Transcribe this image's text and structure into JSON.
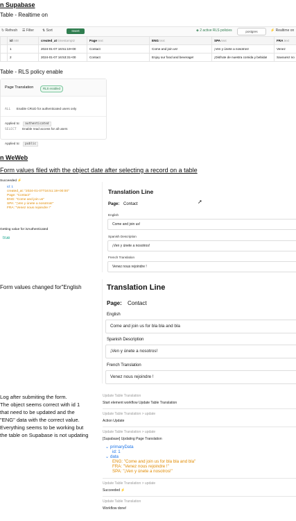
{
  "supabase": {
    "heading": "n Supabase",
    "subheading": "Table - Realtime on",
    "toolbar": {
      "refresh": "Refresh",
      "filter": "Filter",
      "sort": "Sort",
      "insert": "Insert",
      "rls": "2 active RLS policies",
      "role": "postgres",
      "realtime": "Realtime on"
    },
    "table": {
      "headers": [
        {
          "label": "id",
          "type": "int8"
        },
        {
          "label": "created_at",
          "type": "timestamptz"
        },
        {
          "label": "Page",
          "type": "text"
        },
        {
          "label": "ENG",
          "type": "text"
        },
        {
          "label": "SPA",
          "type": "text"
        },
        {
          "label": "FRA",
          "type": "text"
        }
      ],
      "rows": [
        [
          "1",
          "2024-01-07 16:51:19+00",
          "Contact",
          "Come and join us!",
          "¡Ven y únete a nosotros!",
          "Venez"
        ],
        [
          "2",
          "2024-01-07 16:53:31+00",
          "Contact",
          "Enjoy our food and beverage!",
          "¡Disfrute de nuestra comida y bebida!",
          "Savourez no"
        ]
      ]
    },
    "rls_heading": "Table - RLS policy enable",
    "rls_card": {
      "title": "Page Translation",
      "badge": "RLS enabled",
      "policies": [
        {
          "command": "ALL",
          "text": "Enable CRUD for authenticated users only",
          "applied_label": "Applied to:",
          "role": "authenticated"
        },
        {
          "command": "SELECT",
          "text": "Enable read access for all users",
          "applied_label": "Applied to:",
          "role": "public"
        }
      ]
    }
  },
  "weweb": {
    "heading": "n WeWeb",
    "subheading": "Form values filed with the object date after selecting a record on a table",
    "succeeded": "Succeeded",
    "object_lines": [
      "id: 1",
      "created_at: \"2024-01-07T16:51:19+00:00\"",
      "Page: \"Contact\"",
      "ENG: \"Come and join us\"",
      "SPA: \"¡Ven y únete a nosotros!\"",
      "FRA: \"Venez nous rejoindre !\""
    ],
    "getting_value": "Getting value for  isAuthenticated",
    "getting_result": "true",
    "form1": {
      "title": "Translation Line",
      "page_label": "Page:",
      "page_value": "Contact",
      "english_label": "English",
      "english_value": "Come and join us!",
      "spanish_label": "Spanish  Description",
      "spanish_value": "¡Ven y únete a nosotros!",
      "french_label": "French Translation",
      "french_value": "Venez nous rejoindre !"
    },
    "changed_heading": "Form values changed for\"English",
    "form2": {
      "title": "Translation Line",
      "page_label": "Page:",
      "page_value": "Contact",
      "english_label": "English",
      "english_value": "Come and join us for bla bla and bla",
      "spanish_label": "Spanish  Description",
      "spanish_value": "¡Ven y únete a nosotros!",
      "french_label": "French Translation",
      "french_value": "Venez nous rejoindre !"
    },
    "notes": [
      "Log after submiting the form.",
      "The object seems correct with id 1",
      "that need to be updated and the",
      "\"ENG\" data with the correct value.",
      "Everything seems to be working but",
      "the table on Supabase is not updating"
    ],
    "log": {
      "entries": [
        {
          "title": "Update Table Translation",
          "text": "Start element workflow  Update Table Translation"
        },
        {
          "title": "Update Table Translation > update",
          "text": "Action Update"
        },
        {
          "title": "Update Table Translation > update",
          "text": "[Supabase] Updating Page Translation"
        }
      ],
      "primary_key": "primaryData",
      "primary_id": "id: 1",
      "data_key": "data",
      "data_lines": [
        "ENG: \"Come and join us for bla bla and bla\"",
        "FRA: \"Venez nous rejoindre !\"",
        "SPA: \"¡Ven y únete a nosotros!\""
      ],
      "end_entries": [
        {
          "title": "Update Table Translation > update",
          "text": "Succeeded"
        },
        {
          "title": "Update Table Translation",
          "text": "Workflow done!"
        }
      ]
    }
  },
  "colors": {
    "supabase_green": "#2f7d4f",
    "log_orange": "#e08a00",
    "log_blue": "#1a73e8",
    "log_teal": "#19a38c"
  }
}
